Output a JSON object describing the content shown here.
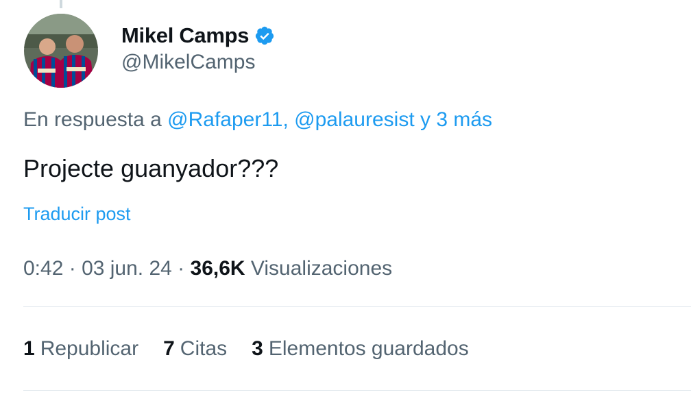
{
  "author": {
    "display_name": "Mikel Camps",
    "handle": "@MikelCamps",
    "verified": true,
    "avatar_icon": "avatar-photo"
  },
  "reply": {
    "prefix": "En respuesta a ",
    "handles": "@Rafaper11, @palauresist",
    "more": " y 3 más"
  },
  "post": {
    "text": "Projecte guanyador???",
    "translate_label": "Traducir post"
  },
  "meta": {
    "time": "0:42",
    "sep1": " · ",
    "date": "03 jun. 24",
    "sep2": " · ",
    "views_count": "36,6K",
    "views_label": " Visualizaciones"
  },
  "stats": [
    {
      "count": "1",
      "label": "Republicar"
    },
    {
      "count": "7",
      "label": "Citas"
    },
    {
      "count": "3",
      "label": "Elementos guardados"
    }
  ],
  "colors": {
    "link": "#1d9bf0",
    "secondary_text": "#536471",
    "primary_text": "#0f1419",
    "verified_badge": "#1d9bf0"
  }
}
